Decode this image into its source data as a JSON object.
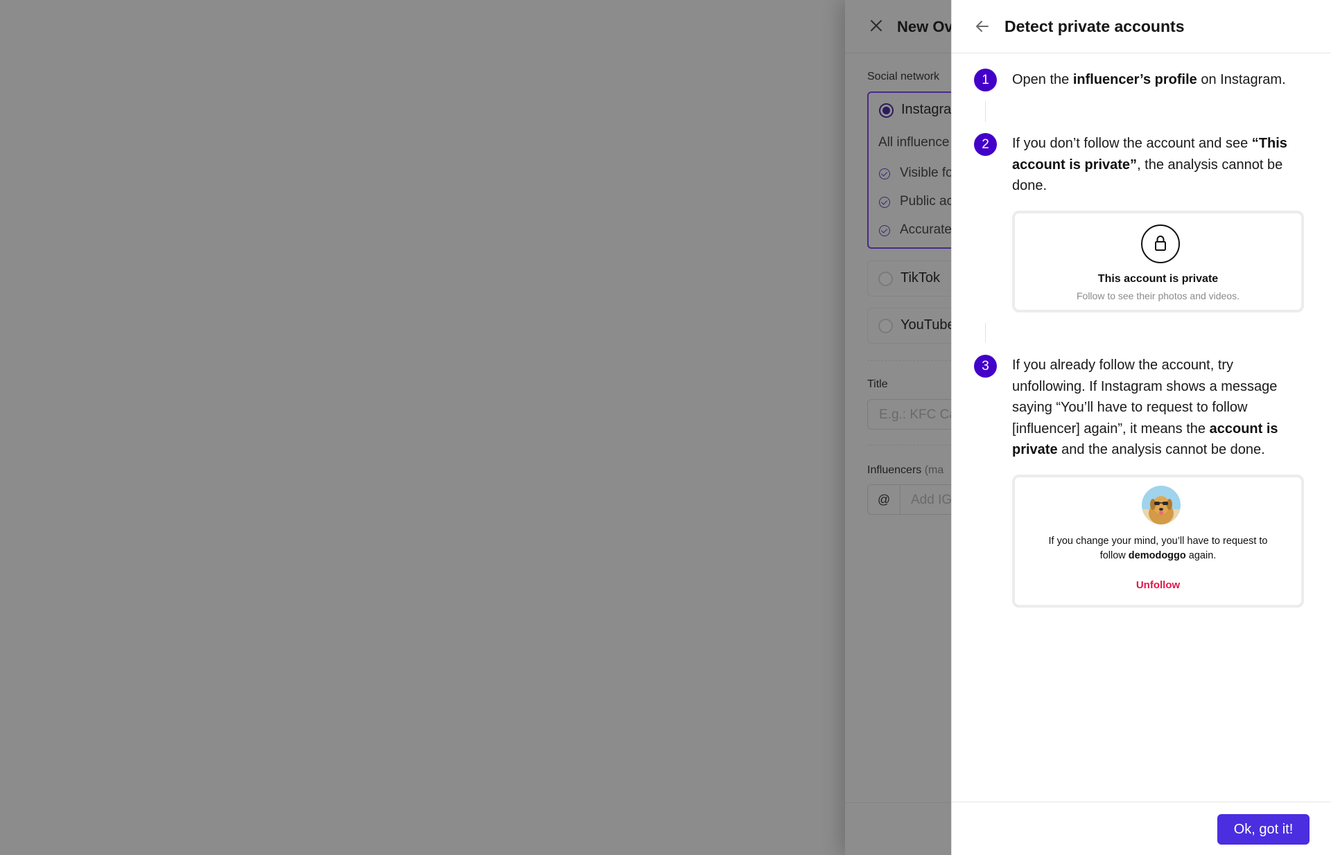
{
  "background_panel": {
    "title": "New Ov",
    "social_network_label": "Social network",
    "options": [
      {
        "label": "Instagra",
        "selected": true
      },
      {
        "label": "TikTok",
        "selected": false
      },
      {
        "label": "YouTube",
        "selected": false
      }
    ],
    "instagram_subtitle": "All influence",
    "instagram_checks": [
      "Visible fo",
      "Public ac",
      "Accurate"
    ],
    "title_label": "Title",
    "title_placeholder": "E.g.: KFC Ca",
    "influencers_label": "Influencers",
    "influencers_hint": "(ma",
    "at_symbol": "@",
    "influencers_placeholder": "Add IG"
  },
  "drawer": {
    "title": "Detect private accounts",
    "steps": [
      {
        "number": "1",
        "parts": [
          {
            "text": "Open the "
          },
          {
            "text": "influencer’s profile",
            "bold": true
          },
          {
            "text": " on Instagram."
          }
        ]
      },
      {
        "number": "2",
        "parts": [
          {
            "text": "If you don’t follow the account and see "
          },
          {
            "text": "“This account is private”",
            "bold": true
          },
          {
            "text": ", the analysis cannot be done."
          }
        ]
      },
      {
        "number": "3",
        "parts": [
          {
            "text": "If you already follow the account, try unfollowing. If Instagram shows a message saying “You’ll have to request to follow [influencer] again”, it means the "
          },
          {
            "text": "account is private",
            "bold": true
          },
          {
            "text": " and the analysis cannot be done."
          }
        ]
      }
    ],
    "private_card": {
      "title": "This account is private",
      "subtitle": "Follow to see their photos and videos."
    },
    "unfollow_card": {
      "text_before": "If you change your mind, you’ll have to request to follow ",
      "username": "demodoggo",
      "text_after": " again.",
      "action": "Unfollow"
    },
    "ok_button": "Ok, got it!"
  },
  "colors": {
    "step_badge": "#4300c8",
    "primary_button": "#4a2ee0",
    "unfollow": "#e0174a",
    "backdrop": "#8c8c8c"
  }
}
